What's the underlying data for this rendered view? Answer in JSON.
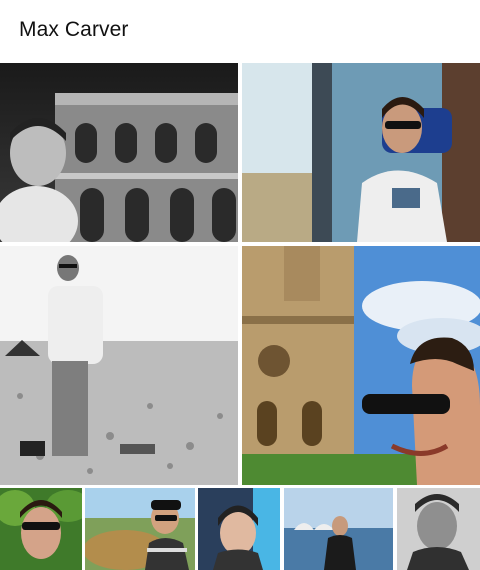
{
  "header": {
    "title": "Max Carver"
  },
  "photos": [
    {
      "id": "photo-1",
      "description": "bw-selfie-colosseum"
    },
    {
      "id": "photo-2",
      "description": "man-sunglasses-train-seat"
    },
    {
      "id": "photo-3",
      "description": "bw-man-standing-beach"
    },
    {
      "id": "photo-4",
      "description": "selfie-notre-dame-cathedral"
    },
    {
      "id": "photo-5",
      "description": "selfie-green-trees"
    },
    {
      "id": "photo-6",
      "description": "selfie-rocky-coast-cap"
    },
    {
      "id": "photo-7",
      "description": "selfie-beanie-indoors"
    },
    {
      "id": "photo-8",
      "description": "man-by-harbor-opera-house"
    },
    {
      "id": "photo-9",
      "description": "bw-portrait-dark"
    }
  ]
}
